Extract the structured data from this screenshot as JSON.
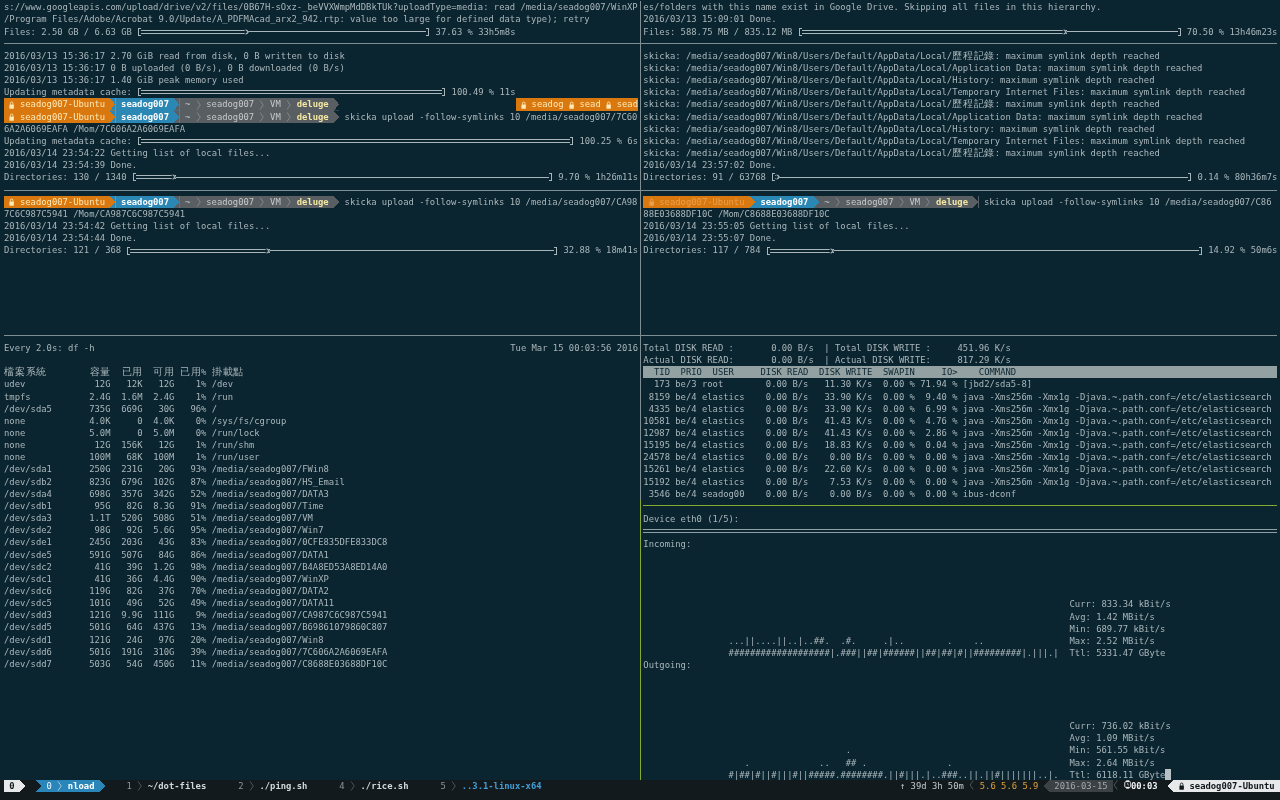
{
  "log_panes": [
    {
      "left": {
        "lines": [
          {
            "kind": "text",
            "text": "s://www.googleapis.com/upload/drive/v2/files/0B67H-sOxz-_beVVXWmpMdDBkTUk?uploadType=media: read /media/seadog007/WinXP"
          },
          {
            "kind": "text",
            "text": "/Program Files/Adobe/Acrobat 9.0/Update/A_PDFMAcad_arx2_942.rtp: value too large for defined data type); retry"
          },
          {
            "kind": "progress",
            "label": "Files: 2.50 GB / 6.63 GB",
            "level": 0.3763,
            "reading": "37.63 % 33h5m8s"
          }
        ]
      },
      "right": {
        "lines": [
          {
            "kind": "text",
            "text": "es/folders with this name exist in Google Drive. Skipping all files in this hierarchy."
          },
          {
            "kind": "text",
            "text": "2016/03/13 15:09:01 Done."
          },
          {
            "kind": "progress",
            "label": "Files: 588.75 MB / 835.12 MB",
            "level": 0.705,
            "reading": "70.50 % 13h46m23s"
          }
        ]
      }
    },
    {
      "left": {
        "lines": [
          {
            "kind": "text",
            "text": "2016/03/13 15:36:17 2.70 GiB read from disk, 0 B written to disk"
          },
          {
            "kind": "text",
            "text": "2016/03/13 15:36:17 0 B uploaded (0 B/s), 0 B downloaded (0 B/s)"
          },
          {
            "kind": "text",
            "text": "2016/03/13 15:36:17 1.40 GiB peak memory used"
          },
          {
            "kind": "progress",
            "label": "Updating metadata cache:",
            "level": 1,
            "reading": "100.49 % 11s"
          },
          {
            "kind": "prompt",
            "host": "seadog007-Ubuntu",
            "faded": false,
            "user": "seadog007",
            "path": [
              "~",
              "seadog007",
              "VM",
              "deluge"
            ],
            "right_prompt": [
              "seadog",
              "sead",
              "sead"
            ]
          },
          {
            "kind": "prompt",
            "host": "seadog007-Ubuntu",
            "faded": false,
            "user": "seadog007",
            "path": [
              "~",
              "seadog007",
              "VM",
              "deluge"
            ],
            "command": "skicka upload -follow-symlinks 10 /media/seadog007/7C60"
          },
          {
            "kind": "text",
            "text": "6A2A6069EAFA /Mom/7C606A2A6069EAFA"
          },
          {
            "kind": "progress",
            "label": "Updating metadata cache:",
            "level": 1,
            "reading": "100.25 % 6s"
          },
          {
            "kind": "text",
            "text": "2016/03/14 23:54:22 Getting list of local files..."
          },
          {
            "kind": "text",
            "text": "2016/03/14 23:54:39 Done."
          },
          {
            "kind": "progress",
            "label": "Directories: 130 / 1340",
            "level": 0.097,
            "reading": "9.70 % 1h26m11s"
          }
        ]
      },
      "right": {
        "lines": [
          {
            "kind": "text",
            "text": "skicka: /media/seadog007/Win8/Users/Default/AppData/Local/歷程記錄: maximum symlink depth reached"
          },
          {
            "kind": "text",
            "text": "skicka: /media/seadog007/Win8/Users/Default/AppData/Local/Application Data: maximum symlink depth reached"
          },
          {
            "kind": "text",
            "text": "skicka: /media/seadog007/Win8/Users/Default/AppData/Local/History: maximum symlink depth reached"
          },
          {
            "kind": "text",
            "text": "skicka: /media/seadog007/Win8/Users/Default/AppData/Local/Temporary Internet Files: maximum symlink depth reached"
          },
          {
            "kind": "text",
            "text": "skicka: /media/seadog007/Win8/Users/Default/AppData/Local/歷程記錄: maximum symlink depth reached"
          },
          {
            "kind": "text",
            "text": "skicka: /media/seadog007/Win8/Users/Default/AppData/Local/Application Data: maximum symlink depth reached"
          },
          {
            "kind": "text",
            "text": "skicka: /media/seadog007/Win8/Users/Default/AppData/Local/History: maximum symlink depth reached"
          },
          {
            "kind": "text",
            "text": "skicka: /media/seadog007/Win8/Users/Default/AppData/Local/Temporary Internet Files: maximum symlink depth reached"
          },
          {
            "kind": "text",
            "text": "skicka: /media/seadog007/Win8/Users/Default/AppData/Local/歷程記錄: maximum symlink depth reached"
          },
          {
            "kind": "text",
            "text": "2016/03/14 23:57:02 Done."
          },
          {
            "kind": "progress",
            "label": "Directories: 91 / 63768",
            "level": 0.0014,
            "reading": "0.14 % 80h36m7s"
          }
        ]
      }
    },
    {
      "left": {
        "lines": [
          {
            "kind": "prompt",
            "host": "seadog007-Ubuntu",
            "faded": false,
            "user": "seadog007",
            "path": [
              "~",
              "seadog007",
              "VM",
              "deluge"
            ],
            "command": "skicka upload -follow-symlinks 10 /media/seadog007/CA98"
          },
          {
            "kind": "text",
            "text": "7C6C987C5941 /Mom/CA987C6C987C5941"
          },
          {
            "kind": "text",
            "text": "2016/03/14 23:54:42 Getting list of local files..."
          },
          {
            "kind": "text",
            "text": "2016/03/14 23:54:44 Done."
          },
          {
            "kind": "progress",
            "label": "Directories: 121 / 368",
            "level": 0.3288,
            "reading": "32.88 % 18m41s"
          }
        ]
      },
      "right": {
        "lines": [
          {
            "kind": "prompt",
            "host": "seadog007-Ubuntu",
            "faded": true,
            "user": "seadog007",
            "path": [
              "~",
              "seadog007",
              "VM",
              "deluge"
            ],
            "command": "skicka upload -follow-symlinks 10 /media/seadog007/C86"
          },
          {
            "kind": "text",
            "text": "88E03688DF10C /Mom/C8688E03688DF10C"
          },
          {
            "kind": "text",
            "text": "2016/03/14 23:55:05 Getting list of local files..."
          },
          {
            "kind": "text",
            "text": "2016/03/14 23:55:07 Done."
          },
          {
            "kind": "progress",
            "label": "Directories: 117 / 784",
            "level": 0.1492,
            "reading": "14.92 % 50m6s"
          }
        ]
      }
    }
  ],
  "df": {
    "command": "Every 2.0s: df -h",
    "timestamp": "Tue Mar 15 00:03:56 2016",
    "columns": [
      "檔案系統",
      "容量",
      "已用",
      "可用",
      "已用%",
      "掛載點"
    ],
    "rows": [
      [
        "udev",
        "12G",
        "12K",
        "12G",
        "1%",
        "/dev"
      ],
      [
        "tmpfs",
        "2.4G",
        "1.6M",
        "2.4G",
        "1%",
        "/run"
      ],
      [
        "/dev/sda5",
        "735G",
        "669G",
        "30G",
        "96%",
        "/"
      ],
      [
        "none",
        "4.0K",
        "0",
        "4.0K",
        "0%",
        "/sys/fs/cgroup"
      ],
      [
        "none",
        "5.0M",
        "0",
        "5.0M",
        "0%",
        "/run/lock"
      ],
      [
        "none",
        "12G",
        "156K",
        "12G",
        "1%",
        "/run/shm"
      ],
      [
        "none",
        "100M",
        "68K",
        "100M",
        "1%",
        "/run/user"
      ],
      [
        "/dev/sda1",
        "250G",
        "231G",
        "20G",
        "93%",
        "/media/seadog007/FWin8"
      ],
      [
        "/dev/sdb2",
        "823G",
        "679G",
        "102G",
        "87%",
        "/media/seadog007/HS_Email"
      ],
      [
        "/dev/sda4",
        "698G",
        "357G",
        "342G",
        "52%",
        "/media/seadog007/DATA3"
      ],
      [
        "/dev/sdb1",
        "95G",
        "82G",
        "8.3G",
        "91%",
        "/media/seadog007/Time"
      ],
      [
        "/dev/sda3",
        "1.1T",
        "520G",
        "508G",
        "51%",
        "/media/seadog007/VM"
      ],
      [
        "/dev/sde2",
        "98G",
        "92G",
        "5.6G",
        "95%",
        "/media/seadog007/Win7"
      ],
      [
        "/dev/sde1",
        "245G",
        "203G",
        "43G",
        "83%",
        "/media/seadog007/0CFE835DFE833DC8"
      ],
      [
        "/dev/sde5",
        "591G",
        "507G",
        "84G",
        "86%",
        "/media/seadog007/DATA1"
      ],
      [
        "/dev/sdc2",
        "41G",
        "39G",
        "1.2G",
        "98%",
        "/media/seadog007/B4A8ED53A8ED14A0"
      ],
      [
        "/dev/sdc1",
        "41G",
        "36G",
        "4.4G",
        "90%",
        "/media/seadog007/WinXP"
      ],
      [
        "/dev/sdc6",
        "119G",
        "82G",
        "37G",
        "70%",
        "/media/seadog007/DATA2"
      ],
      [
        "/dev/sdc5",
        "101G",
        "49G",
        "52G",
        "49%",
        "/media/seadog007/DATA11"
      ],
      [
        "/dev/sdd3",
        "121G",
        "9.9G",
        "111G",
        "9%",
        "/media/seadog007/CA987C6C987C5941"
      ],
      [
        "/dev/sdd5",
        "501G",
        "64G",
        "437G",
        "13%",
        "/media/seadog007/B69861079860C807"
      ],
      [
        "/dev/sdd1",
        "121G",
        "24G",
        "97G",
        "20%",
        "/media/seadog007/Win8"
      ],
      [
        "/dev/sdd6",
        "501G",
        "191G",
        "310G",
        "39%",
        "/media/seadog007/7C606A2A6069EAFA"
      ],
      [
        "/dev/sdd7",
        "503G",
        "54G",
        "450G",
        "11%",
        "/media/seadog007/C8688E03688DF10C"
      ]
    ]
  },
  "iotop": {
    "summary": [
      "Total DISK READ :       0.00 B/s  | Total DISK WRITE :     451.96 K/s",
      "Actual DISK READ:       0.00 B/s  | Actual DISK WRITE:     817.29 K/s"
    ],
    "columns": [
      "TID",
      "PRIO",
      "USER",
      "DISK READ",
      "DISK WRITE",
      "SWAPIN",
      "IO>",
      "COMMAND"
    ],
    "rows": [
      [
        "173",
        "be/3",
        "root",
        "0.00 B/s",
        "11.30 K/s",
        "0.00 %",
        "71.94 %",
        "[jbd2/sda5-8]"
      ],
      [
        "8159",
        "be/4",
        "elastics",
        "0.00 B/s",
        "33.90 K/s",
        "0.00 %",
        "9.40 %",
        "java -Xms256m -Xmx1g -Djava.~.path.conf=/etc/elasticsearch"
      ],
      [
        "4335",
        "be/4",
        "elastics",
        "0.00 B/s",
        "33.90 K/s",
        "0.00 %",
        "6.99 %",
        "java -Xms256m -Xmx1g -Djava.~.path.conf=/etc/elasticsearch"
      ],
      [
        "10581",
        "be/4",
        "elastics",
        "0.00 B/s",
        "41.43 K/s",
        "0.00 %",
        "4.76 %",
        "java -Xms256m -Xmx1g -Djava.~.path.conf=/etc/elasticsearch"
      ],
      [
        "12987",
        "be/4",
        "elastics",
        "0.00 B/s",
        "41.43 K/s",
        "0.00 %",
        "2.86 %",
        "java -Xms256m -Xmx1g -Djava.~.path.conf=/etc/elasticsearch"
      ],
      [
        "15195",
        "be/4",
        "elastics",
        "0.00 B/s",
        "18.83 K/s",
        "0.00 %",
        "0.04 %",
        "java -Xms256m -Xmx1g -Djava.~.path.conf=/etc/elasticsearch"
      ],
      [
        "24578",
        "be/4",
        "elastics",
        "0.00 B/s",
        "0.00 B/s",
        "0.00 %",
        "0.00 %",
        "java -Xms256m -Xmx1g -Djava.~.path.conf=/etc/elasticsearch"
      ],
      [
        "15261",
        "be/4",
        "elastics",
        "0.00 B/s",
        "22.60 K/s",
        "0.00 %",
        "0.00 %",
        "java -Xms256m -Xmx1g -Djava.~.path.conf=/etc/elasticsearch"
      ],
      [
        "15192",
        "be/4",
        "elastics",
        "0.00 B/s",
        "7.53 K/s",
        "0.00 %",
        "0.00 %",
        "java -Xms256m -Xmx1g -Djava.~.path.conf=/etc/elasticsearch"
      ],
      [
        "3546",
        "be/4",
        "seadog00",
        "0.00 B/s",
        "0.00 B/s",
        "0.00 %",
        "0.00 %",
        "ibus-dconf"
      ]
    ]
  },
  "nload": {
    "device": "Device eth0 (1/5):",
    "sections": [
      {
        "label": "Incoming:",
        "graph_lines": [
          "...||....||..|..##.  .#.     .|..        .    ..",
          "###################|.###||##|######||##|##|#||#########|.|||.|"
        ],
        "stats": [
          "Curr: 833.34 kBit/s",
          "Avg: 1.42 MBit/s",
          "Min: 689.77 kBit/s",
          "Max: 2.52 MBit/s",
          "Ttl: 5331.47 GByte"
        ]
      },
      {
        "label": "Outgoing:",
        "graph_lines": [
          "                      .",
          "   .             ..   ## .               .",
          "#|##|#||#|||#||#####.########.||#|||.|..###..||.||#|||||||..|."
        ],
        "stats": [
          "Curr: 736.02 kBit/s",
          "Avg: 1.09 MBit/s",
          "Min: 561.55 kBit/s",
          "Max: 2.64 MBit/s",
          "Ttl: 6118.11 GByte"
        ]
      }
    ]
  },
  "status_bar": {
    "session": "0",
    "windows": [
      {
        "index": "0",
        "name": "nload",
        "selected": true,
        "activity": false
      },
      {
        "index": "1",
        "name": "~/dot-files",
        "selected": false,
        "activity": false
      },
      {
        "index": "2",
        "name": "./ping.sh",
        "selected": false,
        "activity": false
      },
      {
        "index": "4",
        "name": "./rice.sh",
        "selected": false,
        "activity": false
      },
      {
        "index": "5",
        "name": "..3.1-linux-x64",
        "selected": false,
        "activity": true
      }
    ],
    "uptime": "↑ 39d 3h 50m",
    "load": "5.6 5.6 5.9",
    "date": "2016-03-15",
    "time": "00:03",
    "host": "seadog007-Ubuntu"
  }
}
